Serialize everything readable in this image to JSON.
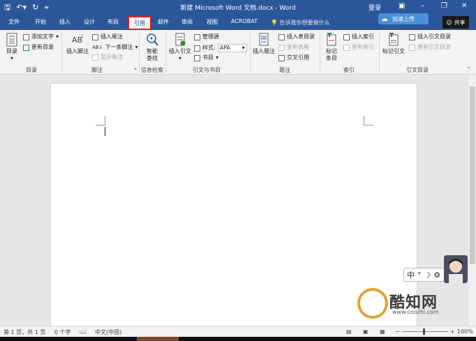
{
  "titlebar": {
    "title": "新建 Microsoft Word 文档.docx - Word",
    "login": "登录",
    "qat_icons": [
      "save-icon",
      "undo-icon",
      "redo-icon",
      "customize-icon"
    ]
  },
  "tabs": [
    "文件",
    "开始",
    "插入",
    "设计",
    "布局",
    "引用",
    "邮件",
    "审阅",
    "视图",
    "ACROBAT"
  ],
  "active_tab": "引用",
  "tell_me": "告诉我你想要做什么",
  "sync_button": "加速上传",
  "share_button": "共享",
  "ribbon": {
    "toc": {
      "toc_label": "目录",
      "add_text": "添加文字",
      "update_toc": "更新目录",
      "group": "目录"
    },
    "footnotes": {
      "insert_footnote": "插入脚注",
      "insert_endnote": "插入尾注",
      "next_footnote": "下一条脚注",
      "show_notes": "显示备注",
      "group": "脚注"
    },
    "research": {
      "smart_lookup_1": "智能",
      "smart_lookup_2": "查找",
      "group": "信息检索"
    },
    "citations": {
      "insert_citation": "插入引文",
      "manage_sources": "管理源",
      "style_label": "样式:",
      "style_value": "APA",
      "bibliography": "书目",
      "group": "引文与书目"
    },
    "captions": {
      "insert_caption": "插入题注",
      "insert_table_of_figures": "插入表目录",
      "update_table": "更新表格",
      "cross_reference": "交叉引用",
      "group": "题注"
    },
    "index": {
      "mark_entry_1": "标记",
      "mark_entry_2": "条目",
      "insert_index": "插入索引",
      "update_index": "更新索引",
      "group": "索引"
    },
    "authorities": {
      "mark_citation": "标记引文",
      "insert_toa": "插入引文目录",
      "update_toa": "更新引文目录",
      "group": "引文目录"
    }
  },
  "ime": {
    "lang": "中",
    "punct": "°",
    "moon": "☽"
  },
  "watermark": {
    "text": "酷知网",
    "url": "www.coozhi.com"
  },
  "status": {
    "page": "第 1 页，共 1 页",
    "words": "0 个字",
    "lang": "中文(中国)",
    "zoom": "100%"
  }
}
